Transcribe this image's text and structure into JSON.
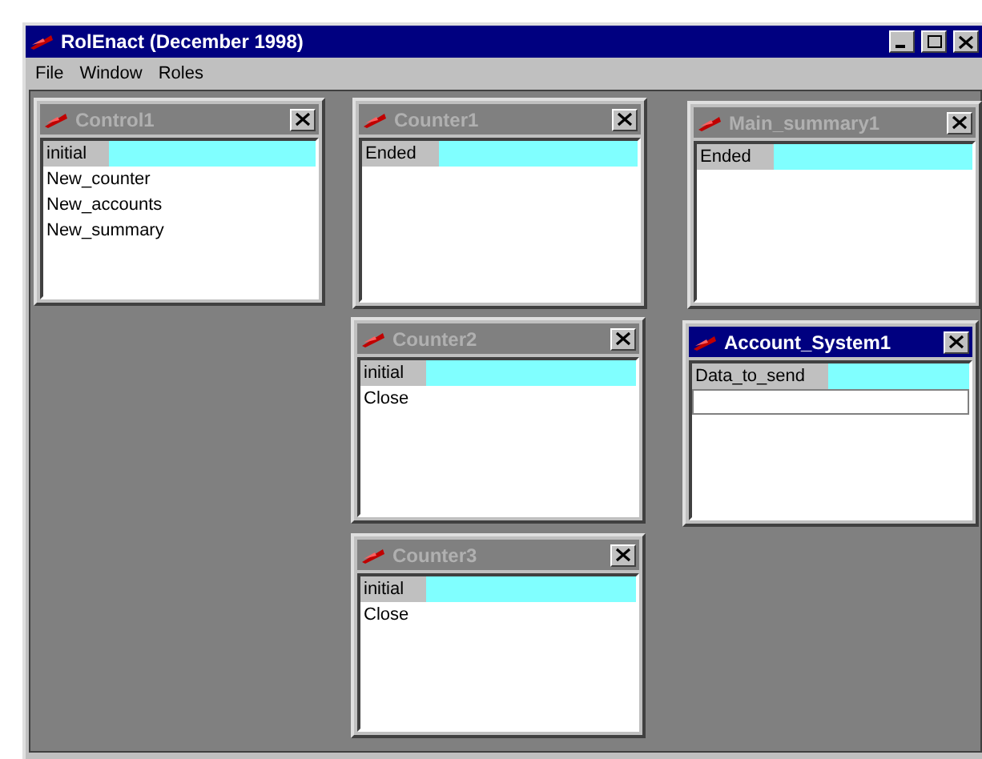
{
  "window": {
    "title": "RolEnact (December 1998)"
  },
  "menu": [
    "File",
    "Window",
    "Roles"
  ],
  "children": [
    {
      "title": "Control1",
      "active": false,
      "items": [
        {
          "label": "initial",
          "selected": true
        },
        {
          "label": "New_counter",
          "selected": false
        },
        {
          "label": "New_accounts",
          "selected": false
        },
        {
          "label": "New_summary",
          "selected": false
        }
      ]
    },
    {
      "title": "Counter1",
      "active": false,
      "items": [
        {
          "label": "Ended",
          "selected": true
        }
      ]
    },
    {
      "title": "Main_summary1",
      "active": false,
      "items": [
        {
          "label": "Ended",
          "selected": true
        }
      ]
    },
    {
      "title": "Counter2",
      "active": false,
      "items": [
        {
          "label": "initial",
          "selected": true
        },
        {
          "label": "Close",
          "selected": false
        }
      ]
    },
    {
      "title": "Account_System1",
      "active": true,
      "input_row": true,
      "items": [
        {
          "label": "Data_to_send",
          "selected": true
        }
      ]
    },
    {
      "title": "Counter3",
      "active": false,
      "items": [
        {
          "label": "initial",
          "selected": true
        },
        {
          "label": "Close",
          "selected": false
        }
      ]
    }
  ]
}
